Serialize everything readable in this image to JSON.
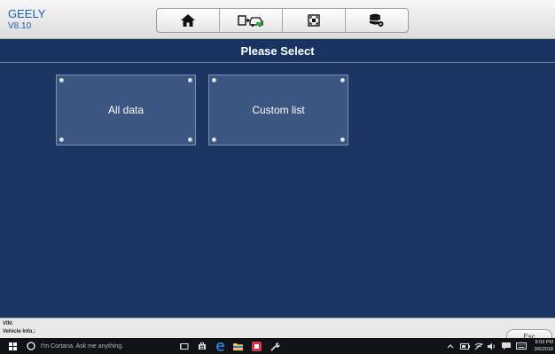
{
  "header": {
    "brand": "GEELY",
    "version": "V8.10",
    "toolbar": [
      {
        "name": "home-icon"
      },
      {
        "name": "vehicle-connect-icon"
      },
      {
        "name": "screenshot-icon"
      },
      {
        "name": "database-settings-icon"
      }
    ]
  },
  "title": "Please Select",
  "tiles": [
    {
      "label": "All data"
    },
    {
      "label": "Custom list"
    }
  ],
  "info": {
    "vin_label": "VIN:",
    "vehicle_label": "Vehicle Info.:",
    "esc_label": "Esc"
  },
  "taskbar": {
    "search_placeholder": "I'm Cortana. Ask me anything.",
    "time": "8:03 PM",
    "date": "3/6/2018"
  },
  "colors": {
    "background": "#1b3462",
    "brand_text": "#1f5fb0",
    "tile": "#3b5680"
  }
}
